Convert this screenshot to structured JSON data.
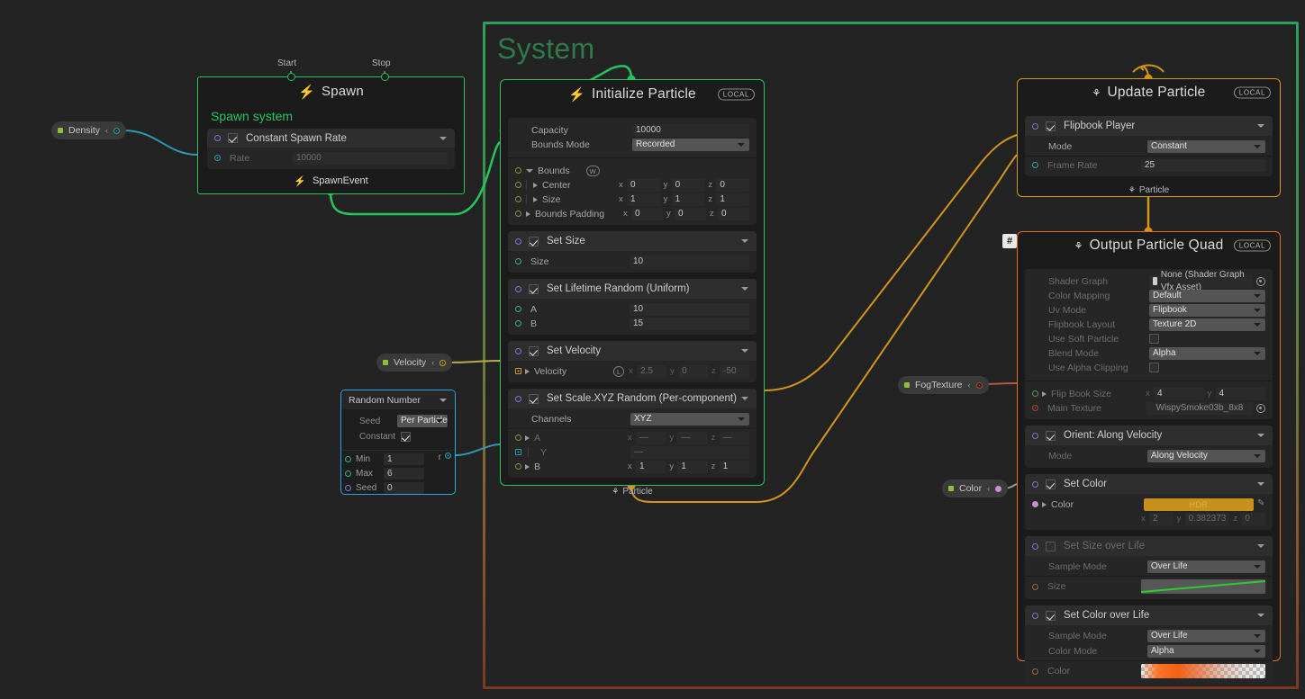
{
  "group": {
    "title": "System"
  },
  "spawn_node": {
    "title": "Spawn",
    "port_start_label": "Start",
    "port_stop_label": "Stop",
    "system_label": "Spawn system",
    "block_label": "Constant Spawn Rate",
    "rate_label": "Rate",
    "rate_value": "10000",
    "event_label": "SpawnEvent"
  },
  "initialize_node": {
    "title": "Initialize Particle",
    "local_badge": "LOCAL",
    "capacity_label": "Capacity",
    "capacity_value": "10000",
    "bounds_mode_label": "Bounds Mode",
    "bounds_mode_value": "Recorded",
    "bounds_label": "Bounds",
    "bounds_space_badge": "W",
    "center_label": "Center",
    "center": {
      "x": "0",
      "y": "0",
      "z": "0"
    },
    "size_label": "Size",
    "size": {
      "x": "1",
      "y": "1",
      "z": "1"
    },
    "bounds_padding_label": "Bounds Padding",
    "bounds_padding": {
      "x": "0",
      "y": "0",
      "z": "0"
    },
    "blocks": [
      {
        "name": "Set Size",
        "enabled": true,
        "rows": [
          {
            "label": "Size",
            "value": "10"
          }
        ]
      },
      {
        "name": "Set Lifetime Random (Uniform)",
        "enabled": true,
        "rows": [
          {
            "label": "A",
            "value": "10"
          },
          {
            "label": "B",
            "value": "15"
          }
        ]
      },
      {
        "name": "Set Velocity",
        "enabled": true,
        "velocity_label": "Velocity",
        "velocity_space_badge": "L",
        "velocity": {
          "x": "2.5",
          "y": "0",
          "z": "-50"
        }
      },
      {
        "name": "Set Scale.XYZ Random (Per-component)",
        "enabled": true,
        "channels_label": "Channels",
        "channels_value": "XYZ",
        "a_label": "A",
        "a": {
          "x": "—",
          "y": "—",
          "z": "—"
        },
        "y_label": "Y",
        "y_value": "—",
        "b_label": "B",
        "b": {
          "x": "1",
          "y": "1",
          "z": "1"
        }
      }
    ],
    "footer": "Particle"
  },
  "update_node": {
    "title": "Update Particle",
    "local_badge": "LOCAL",
    "block_label": "Flipbook Player",
    "mode_label": "Mode",
    "mode_value": "Constant",
    "frame_rate_label": "Frame Rate",
    "frame_rate_value": "25",
    "footer": "Particle"
  },
  "output_node": {
    "title": "Output Particle Quad",
    "local_badge": "LOCAL",
    "badge_hash": "#",
    "settings": [
      {
        "label": "Shader Graph",
        "value": "None (Shader Graph Vfx Asset)",
        "kind": "object"
      },
      {
        "label": "Color Mapping",
        "value": "Default",
        "kind": "dropdown"
      },
      {
        "label": "Uv Mode",
        "value": "Flipbook",
        "kind": "dropdown"
      },
      {
        "label": "Flipbook Layout",
        "value": "Texture 2D",
        "kind": "dropdown"
      },
      {
        "label": "Use Soft Particle",
        "value": "",
        "kind": "checkbox"
      },
      {
        "label": "Blend Mode",
        "value": "Alpha",
        "kind": "dropdown"
      },
      {
        "label": "Use Alpha Clipping",
        "value": "",
        "kind": "checkbox"
      }
    ],
    "flipbook_size_label": "Flip Book Size",
    "flipbook_size": {
      "x": "4",
      "y": "4"
    },
    "main_texture_label": "Main Texture",
    "main_texture_value": "WispySmoke03b_8x8",
    "blocks": [
      {
        "name": "Orient: Along Velocity",
        "enabled": true,
        "mode_label": "Mode",
        "mode_value": "Along Velocity"
      },
      {
        "name": "Set Color",
        "enabled": true,
        "color_label": "Color",
        "hdr_label": "HDR",
        "color_swatch": "#c8901c",
        "color_vec": {
          "x": "2",
          "y": "0.382373",
          "z": "0"
        }
      },
      {
        "name": "Set Size over Life",
        "enabled": false,
        "sample_mode_label": "Sample Mode",
        "sample_mode_value": "Over Life",
        "size_label": "Size",
        "curve_color": "#2ecc2e"
      },
      {
        "name": "Set Color over Life",
        "enabled": true,
        "sample_mode_label": "Sample Mode",
        "sample_mode_value": "Over Life",
        "color_mode_label": "Color Mode",
        "color_mode_value": "Alpha",
        "color_label": "Color"
      }
    ]
  },
  "random_node": {
    "title": "Random Number",
    "seed_label": "Seed",
    "seed_mode_value": "Per Particle",
    "constant_label": "Constant",
    "constant_checked": true,
    "min_label": "Min",
    "min_value": "1",
    "max_label": "Max",
    "max_value": "6",
    "seed_value_label": "Seed",
    "seed_value": "0",
    "output_label": "r"
  },
  "parameters": [
    {
      "name": "Density",
      "collapse": "‹",
      "dot": "#8fbf3f",
      "port": "#2d9ab0"
    },
    {
      "name": "Velocity",
      "collapse": "‹",
      "dot": "#8fbf3f",
      "port": "#c9a227"
    },
    {
      "name": "FogTexture",
      "collapse": "‹",
      "dot": "#8fbf3f",
      "port": "#b04438"
    },
    {
      "name": "Color",
      "collapse": "‹",
      "dot": "#8fbf3f",
      "port": "#c98fd0"
    }
  ],
  "colors": {
    "background": "#232323",
    "spawn_border": "#22c55e",
    "init_border": "#22c55e",
    "update_border": "#d49a1a",
    "output_border": "#e06c30",
    "random_border": "#2aa7d8",
    "wire_green": "#22c55e",
    "wire_teal": "#2d9ab0",
    "wire_orange": "#d4941a",
    "wire_yellow": "#b9ac4a",
    "wire_red": "#b5564a"
  }
}
